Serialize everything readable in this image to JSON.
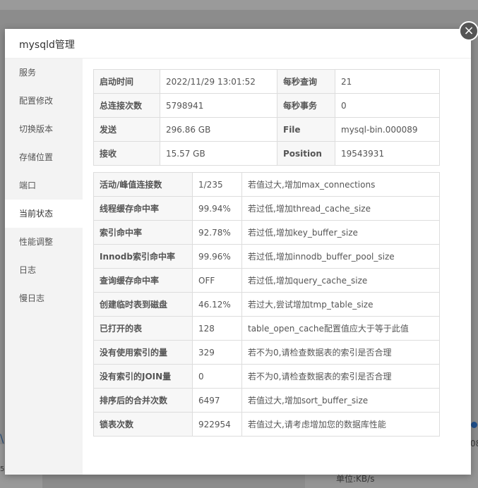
{
  "modal": {
    "title": "mysqld管理",
    "close_glyph": "×"
  },
  "sidebar": {
    "items": [
      {
        "label": "服务"
      },
      {
        "label": "配置修改"
      },
      {
        "label": "切换版本"
      },
      {
        "label": "存储位置"
      },
      {
        "label": "端口"
      },
      {
        "label": "当前状态",
        "active": true
      },
      {
        "label": "性能调整"
      },
      {
        "label": "日志"
      },
      {
        "label": "慢日志"
      }
    ]
  },
  "summary": {
    "rows": [
      {
        "k1": "启动时间",
        "v1": "2022/11/29 13:01:52",
        "k2": "每秒查询",
        "v2": "21"
      },
      {
        "k1": "总连接次数",
        "v1": "5798941",
        "k2": "每秒事务",
        "v2": "0"
      },
      {
        "k1": "发送",
        "v1": "296.86 GB",
        "k2": "File",
        "v2": "mysql-bin.000089"
      },
      {
        "k1": "接收",
        "v1": "15.57 GB",
        "k2": "Position",
        "v2": "19543931"
      }
    ]
  },
  "metrics": {
    "rows": [
      {
        "name": "活动/峰值连接数",
        "value": "1/235",
        "tip": "若值过大,增加max_connections"
      },
      {
        "name": "线程缓存命中率",
        "value": "99.94%",
        "tip": "若过低,增加thread_cache_size"
      },
      {
        "name": "索引命中率",
        "value": "92.78%",
        "tip": "若过低,增加key_buffer_size"
      },
      {
        "name": "Innodb索引命中率",
        "value": "99.96%",
        "tip": "若过低,增加innodb_buffer_pool_size"
      },
      {
        "name": "查询缓存命中率",
        "value": "OFF",
        "tip": "若过低,增加query_cache_size"
      },
      {
        "name": "创建临时表到磁盘",
        "value": "46.12%",
        "tip": "若过大,尝试增加tmp_table_size"
      },
      {
        "name": "已打开的表",
        "value": "128",
        "tip": "table_open_cache配置值应大于等于此值"
      },
      {
        "name": "没有使用索引的量",
        "value": "329",
        "tip": "若不为0,请检查数据表的索引是否合理"
      },
      {
        "name": "没有索引的JOIN量",
        "value": "0",
        "tip": "若不为0,请检查数据表的索引是否合理"
      },
      {
        "name": "排序后的合并次数",
        "value": "6497",
        "tip": "若值过大,增加sort_buffer_size"
      },
      {
        "name": "锁表次数",
        "value": "922954",
        "tip": "若值过大,请考虑增加您的数据库性能"
      }
    ]
  },
  "background": {
    "unit_label": "单位:KB/s"
  },
  "colors": {
    "sidebar_bg": "#f3f3f3",
    "key_cell_bg": "#f7f7f7",
    "overlay": "#8c8c8c"
  }
}
